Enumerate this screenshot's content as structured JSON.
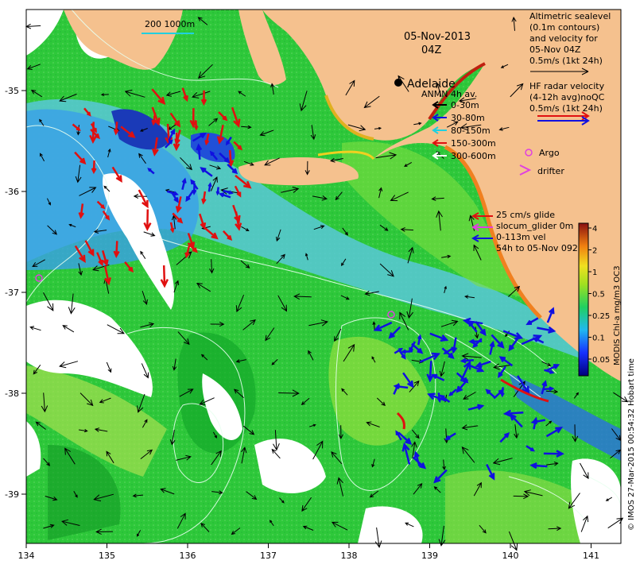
{
  "title": {
    "date": "05-Nov-2013",
    "time": "04Z"
  },
  "scale_bar_label": "200  1000m",
  "city_label": "Adelaide",
  "altimetry_legend": [
    "Altimetric sealevel",
    "(0.1m contours)",
    "and velocity for",
    "05-Nov 04Z",
    "0.5m/s (1kt 24h)"
  ],
  "hf_radar_legend": [
    "HF radar velocity",
    "(4-12h avg)noQC",
    "0.5m/s (1kt 24h)"
  ],
  "anmn_legend": {
    "title": "ANMN 4h av.",
    "items": [
      {
        "label": "0-30m",
        "color": "#000000"
      },
      {
        "label": "30-80m",
        "color": "#1010e0"
      },
      {
        "label": "80-150m",
        "color": "#20d0e0"
      },
      {
        "label": "150-300m",
        "color": "#e01010"
      },
      {
        "label": "300-600m",
        "color": "#ffffff"
      }
    ]
  },
  "argo_label": "Argo",
  "drifter_label": "drifter",
  "glider_legend": [
    "25 cm/s glide",
    "slocum_glider 0m",
    "0-113m vel",
    "54h to 05-Nov 092"
  ],
  "colorbar": {
    "label": "MODIS Chl-a mg/m3 OC3",
    "ticks": [
      "4",
      "2",
      "1",
      "0.5",
      "0.25",
      "0.1",
      "0.05"
    ]
  },
  "credit": "© IMOS 27-Mar-2015 00:54:32 Hobart time",
  "axes": {
    "lon_ticks": [
      "134",
      "135",
      "136",
      "137",
      "138",
      "139",
      "140",
      "141"
    ],
    "lat_ticks": [
      "-35",
      "-36",
      "-37",
      "-38",
      "-39"
    ]
  },
  "colors": {
    "land": "#f5c18e",
    "shelf": "#12cc12",
    "offshore": "#2fbf3f",
    "cloud": "#ffffff",
    "mixed": "#55cfe8"
  }
}
